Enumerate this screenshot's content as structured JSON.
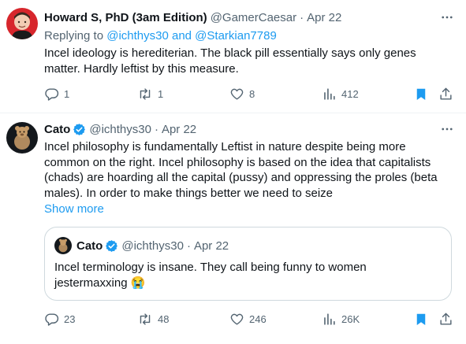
{
  "tweets": [
    {
      "name": "Howard S, PhD (3am Edition)",
      "handle": "@GamerCaesar",
      "date": "Apr 22",
      "replying_prefix": "Replying to",
      "replying_to": "@ichthys30 and @Starkian7789",
      "text": "Incel ideology is herediterian. The black pill essentially says only genes matter. Hardly leftist by this measure.",
      "replies": "1",
      "retweets": "1",
      "likes": "8",
      "views": "412",
      "bookmarked": true
    },
    {
      "name": "Cato",
      "handle": "@ichthys30",
      "date": "Apr 22",
      "verified": true,
      "text": "Incel philosophy is fundamentally Leftist in nature despite being more common on the right. Incel philosophy is based on the idea that capitalists (chads) are hoarding all the capital (pussy) and oppressing the proles (beta males). In order to make things better we need to seize",
      "show_more": "Show more",
      "quote": {
        "name": "Cato",
        "handle": "@ichthys30",
        "date": "Apr 22",
        "text": "Incel terminology is insane. They call being funny to women jestermaxxing 😭"
      },
      "replies": "23",
      "retweets": "48",
      "likes": "246",
      "views": "26K",
      "bookmarked": true
    }
  ],
  "separator": "·",
  "colors": {
    "accent": "#1d9bf0",
    "secondary_text": "#536471",
    "primary_text": "#0f1419"
  },
  "icons": {
    "more": "more-icon",
    "reply": "reply-icon",
    "retweet": "retweet-icon",
    "like": "like-icon",
    "views": "views-icon",
    "bookmark": "bookmark-icon",
    "share": "share-icon",
    "verified": "verified-badge-icon"
  }
}
